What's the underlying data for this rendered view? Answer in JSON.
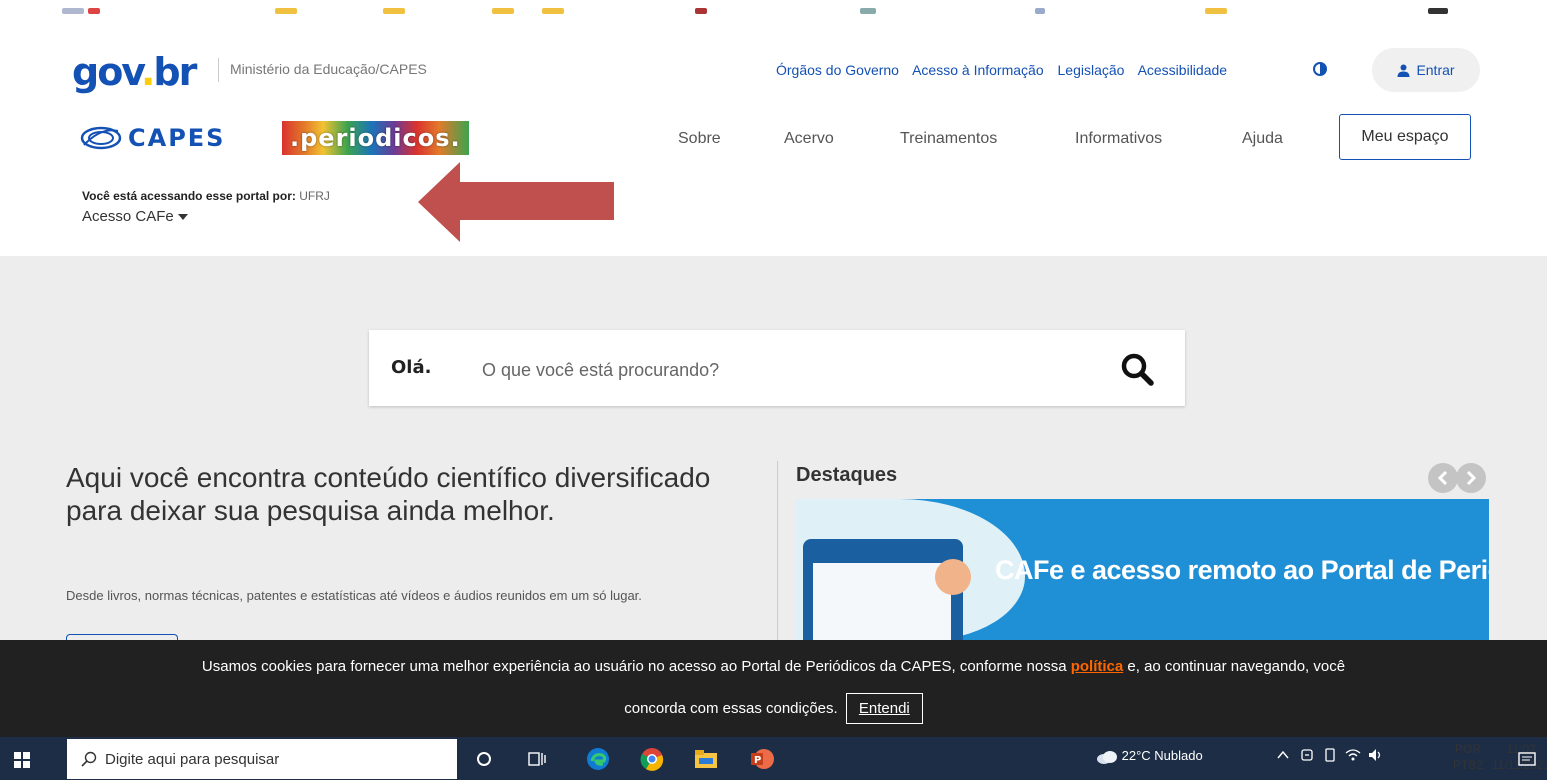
{
  "header": {
    "logo_gov": "gov",
    "logo_br": "br",
    "ministry": "Ministério da Educação/CAPES",
    "top_links": [
      "Órgãos do Governo",
      "Acesso à Informação",
      "Legislação",
      "Acessibilidade"
    ],
    "login_label": "Entrar",
    "capes_label": "CAPES",
    "periodicos_label": ".periodicos.",
    "nav": [
      "Sobre",
      "Acervo",
      "Treinamentos",
      "Informativos",
      "Ajuda"
    ],
    "meu_espaco": "Meu espaço",
    "access_prefix": "Você está acessando esse portal por:",
    "access_institution": "UFRJ",
    "access_method": "Acesso CAFe"
  },
  "search": {
    "greeting": "Olá.",
    "placeholder": "O que você está procurando?"
  },
  "hero": {
    "title": "Aqui você encontra conteúdo científico diversificado para deixar sua pesquisa ainda melhor.",
    "subtitle": "Desde livros, normas técnicas, patentes e estatísticas até vídeos e áudios reunidos em um só lugar."
  },
  "highlights": {
    "heading": "Destaques",
    "banner_title": "CAFe e acesso remoto ao Portal de Periódicos"
  },
  "cookie": {
    "text_before": "Usamos cookies para fornecer uma melhor experiência ao usuário no acesso ao Portal de Periódicos da CAPES, conforme nossa",
    "link_label": "política",
    "text_after": "e, ao continuar navegando, você",
    "line2": "concorda com essas condições.",
    "accept_label": "Entendi"
  },
  "taskbar": {
    "search_placeholder": "Digite aqui para pesquisar",
    "weather": "22°C  Nublado",
    "lang_top": "POR",
    "lang_bottom": "PTB2",
    "time": "11:02",
    "date": "11/11/2021"
  },
  "colors": {
    "gov_blue": "#1351b4",
    "annotation_arrow": "#c0504d",
    "cookie_link": "#ff6600"
  }
}
